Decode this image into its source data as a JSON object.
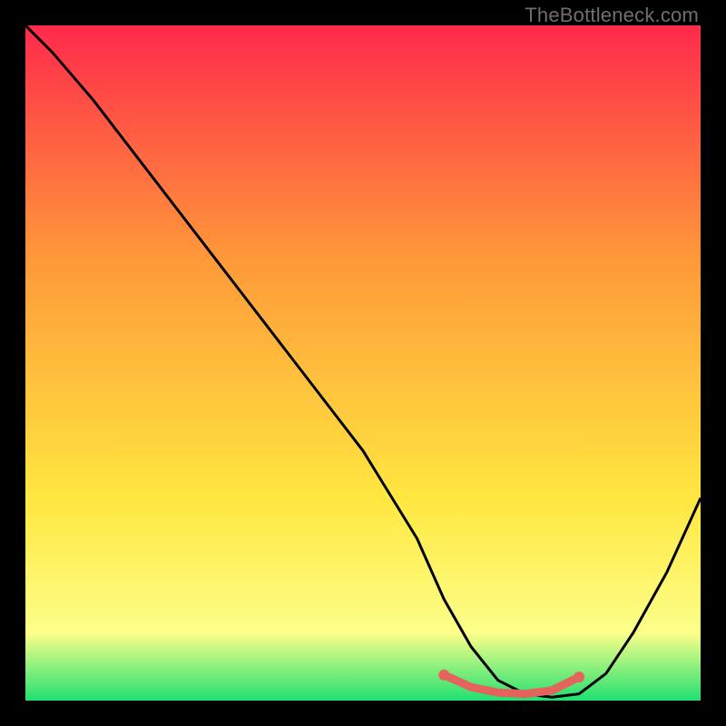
{
  "watermark": "TheBottleneck.com",
  "colors": {
    "gradient_top": "#ff2a4b",
    "gradient_mid1": "#ff9a3a",
    "gradient_mid2": "#ffe740",
    "gradient_low": "#fcff8a",
    "gradient_bottom": "#20e070",
    "curve": "#000000",
    "accent_min": "#e4635c",
    "frame": "#000000"
  },
  "chart_data": {
    "type": "line",
    "title": "",
    "xlabel": "",
    "ylabel": "",
    "xlim": [
      0,
      100
    ],
    "ylim": [
      0,
      100
    ],
    "series": [
      {
        "name": "bottleneck-curve",
        "x": [
          0,
          4,
          10,
          20,
          30,
          40,
          50,
          58,
          62,
          66,
          70,
          74,
          78,
          82,
          86,
          90,
          95,
          100
        ],
        "y": [
          100,
          96,
          89,
          76,
          63,
          50,
          37,
          24,
          15,
          8,
          3,
          1,
          0.5,
          1,
          4,
          10,
          19,
          30
        ]
      },
      {
        "name": "optimal-range",
        "x": [
          62,
          66,
          70,
          74,
          78,
          82
        ],
        "y": [
          3.8,
          2.0,
          1.2,
          1.0,
          1.5,
          3.5
        ]
      }
    ],
    "annotations": []
  }
}
